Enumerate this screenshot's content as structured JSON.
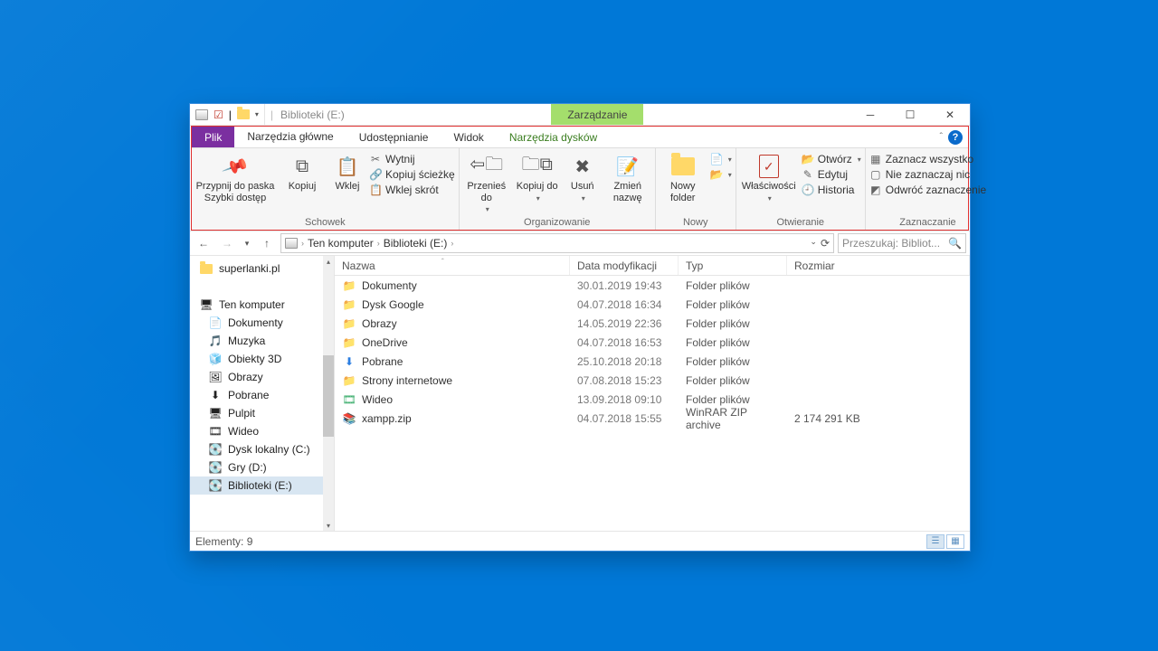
{
  "titlebar": {
    "title": "Biblioteki (E:)",
    "context_tab": "Zarządzanie"
  },
  "tabs": {
    "file": "Plik",
    "home": "Narzędzia główne",
    "share": "Udostępnianie",
    "view": "Widok",
    "disk_tools": "Narzędzia dysków"
  },
  "ribbon": {
    "pin_to_quick_access": "Przypnij do paska\nSzybki dostęp",
    "copy": "Kopiuj",
    "paste": "Wklej",
    "cut": "Wytnij",
    "copy_path": "Kopiuj ścieżkę",
    "paste_shortcut": "Wklej skrót",
    "group_clipboard": "Schowek",
    "move_to": "Przenieś\ndo",
    "copy_to": "Kopiuj\ndo",
    "delete": "Usuń",
    "rename": "Zmień\nnazwę",
    "group_organize": "Organizowanie",
    "new_folder": "Nowy\nfolder",
    "group_new": "Nowy",
    "properties": "Właściwości",
    "open": "Otwórz",
    "edit": "Edytuj",
    "history": "Historia",
    "group_open": "Otwieranie",
    "select_all": "Zaznacz wszystko",
    "select_none": "Nie zaznaczaj nic",
    "invert_selection": "Odwróć zaznaczenie",
    "group_select": "Zaznaczanie"
  },
  "breadcrumbs": [
    "Ten komputer",
    "Biblioteki (E:)"
  ],
  "search_placeholder": "Przeszukaj: Bibliot...",
  "navpane": {
    "quick": "superlanki.pl",
    "this_pc": "Ten komputer",
    "items": [
      "Dokumenty",
      "Muzyka",
      "Obiekty 3D",
      "Obrazy",
      "Pobrane",
      "Pulpit",
      "Wideo",
      "Dysk lokalny (C:)",
      "Gry (D:)",
      "Biblioteki (E:)"
    ],
    "selected_index": 9
  },
  "columns": {
    "name": "Nazwa",
    "date": "Data modyfikacji",
    "type": "Typ",
    "size": "Rozmiar"
  },
  "rows": [
    {
      "icon": "folder",
      "name": "Dokumenty",
      "date": "30.01.2019 19:43",
      "type": "Folder plików",
      "size": ""
    },
    {
      "icon": "folder",
      "name": "Dysk Google",
      "date": "04.07.2018 16:34",
      "type": "Folder plików",
      "size": ""
    },
    {
      "icon": "folder",
      "name": "Obrazy",
      "date": "14.05.2019 22:36",
      "type": "Folder plików",
      "size": ""
    },
    {
      "icon": "folder",
      "name": "OneDrive",
      "date": "04.07.2018 16:53",
      "type": "Folder plików",
      "size": ""
    },
    {
      "icon": "download",
      "name": "Pobrane",
      "date": "25.10.2018 20:18",
      "type": "Folder plików",
      "size": ""
    },
    {
      "icon": "folder",
      "name": "Strony internetowe",
      "date": "07.08.2018 15:23",
      "type": "Folder plików",
      "size": ""
    },
    {
      "icon": "video",
      "name": "Wideo",
      "date": "13.09.2018 09:10",
      "type": "Folder plików",
      "size": ""
    },
    {
      "icon": "zip",
      "name": "xampp.zip",
      "date": "04.07.2018 15:55",
      "type": "WinRAR ZIP archive",
      "size": "2 174 291 KB"
    }
  ],
  "statusbar": {
    "item_count": "Elementy: 9"
  },
  "navpane_icons": [
    "📄",
    "🎵",
    "🧊",
    "🖼",
    "⬇",
    "🖥",
    "🎞",
    "💽",
    "💽",
    "💽"
  ]
}
